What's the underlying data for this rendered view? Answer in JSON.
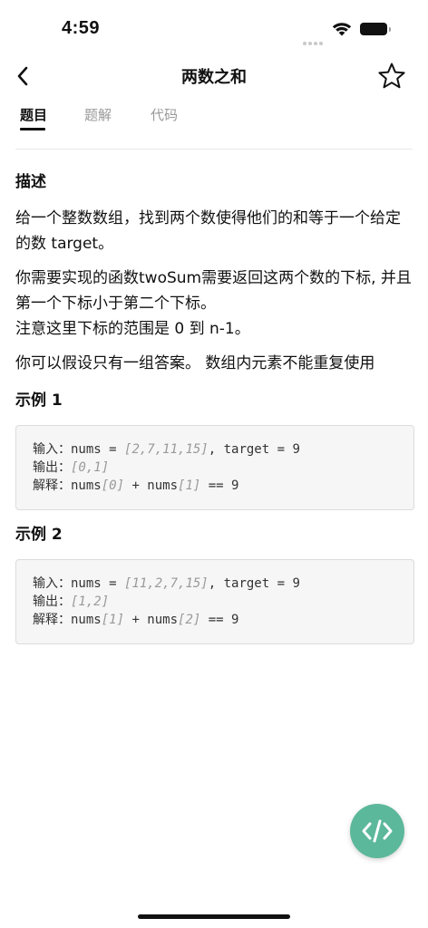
{
  "status_bar": {
    "time": "4:59"
  },
  "nav": {
    "title": "两数之和",
    "back_icon": "chevron-left-icon",
    "favorite_icon": "star-outline-icon"
  },
  "tabs": [
    {
      "label": "题目",
      "active": true
    },
    {
      "label": "题解",
      "active": false
    },
    {
      "label": "代码",
      "active": false
    }
  ],
  "description": {
    "heading": "描述",
    "paragraphs": [
      "给一个整数数组，找到两个数使得他们的和等于一个给定的数 target。",
      "你需要实现的函数twoSum需要返回这两个数的下标, 并且第一个下标小于第二个下标。",
      "注意这里下标的范围是 0 到 n-1。",
      "你可以假设只有一组答案。 数组内元素不能重复使用"
    ]
  },
  "examples": [
    {
      "heading": "示例 1",
      "input_label": "输入：",
      "input_prefix": "nums = ",
      "input_array": "[2,7,11,15]",
      "input_suffix": ", target = 9",
      "output_label": "输出：",
      "output_value": "[0,1]",
      "explain_label": "解释：",
      "explain_a": "nums",
      "explain_a_index": "[0]",
      "explain_plus": " + nums",
      "explain_b_index": "[1]",
      "explain_result": " == 9"
    },
    {
      "heading": "示例 2",
      "input_label": "输入：",
      "input_prefix": "nums = ",
      "input_array": "[11,2,7,15]",
      "input_suffix": ", target = 9",
      "output_label": "输出：",
      "output_value": "[1,2]",
      "explain_label": "解释：",
      "explain_a": "nums",
      "explain_a_index": "[1]",
      "explain_plus": " + nums",
      "explain_b_index": "[2]",
      "explain_result": " == 9"
    }
  ],
  "fab": {
    "icon": "code-icon",
    "color": "#5cb89a"
  }
}
